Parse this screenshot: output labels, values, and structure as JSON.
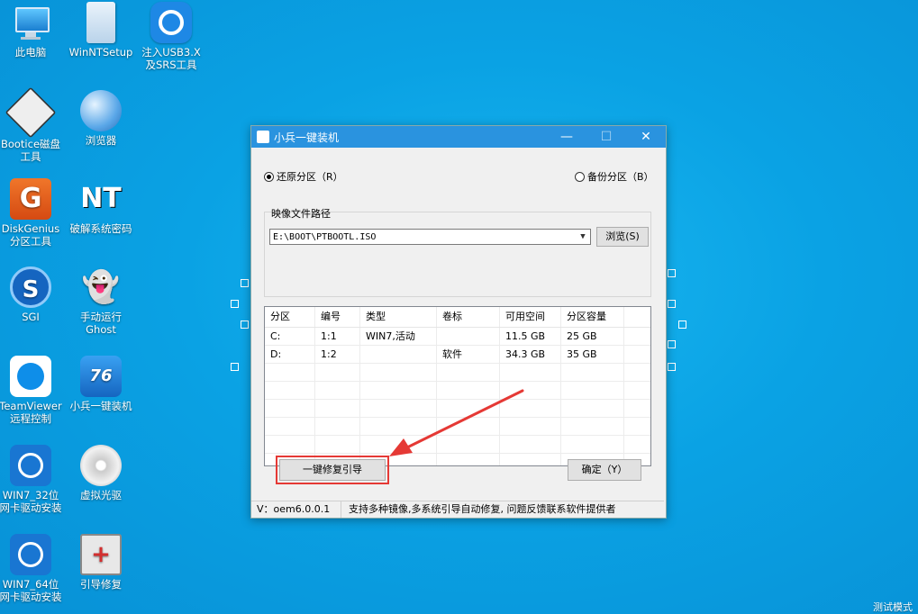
{
  "desktop": {
    "icons": [
      {
        "label": "此电脑",
        "label2": ""
      },
      {
        "label": "WinNTSetup",
        "label2": ""
      },
      {
        "label": "注入USB3.X",
        "label2": "及SRS工具"
      },
      {
        "label": "Bootice磁盘",
        "label2": "工具"
      },
      {
        "label": "浏览器",
        "label2": ""
      },
      {
        "label": "DiskGenius",
        "label2": "分区工具"
      },
      {
        "label": "破解系统密码",
        "label2": ""
      },
      {
        "label": "SGI",
        "label2": ""
      },
      {
        "label": "手动运行",
        "label2": "Ghost"
      },
      {
        "label": "TeamViewer",
        "label2": "远程控制"
      },
      {
        "label": "小兵一键装机",
        "label2": ""
      },
      {
        "label": "WIN7_32位",
        "label2": "网卡驱动安装"
      },
      {
        "label": "虚拟光驱",
        "label2": ""
      },
      {
        "label": "WIN7_64位",
        "label2": "网卡驱动安装"
      },
      {
        "label": "引导修复",
        "label2": ""
      }
    ],
    "corner_text": "测试模式"
  },
  "window": {
    "title": "小兵一键装机",
    "minimize": "—",
    "maximize": "☐",
    "close": "✕",
    "radio_restore": "还原分区（R）",
    "radio_backup": "备份分区（B）",
    "image_path_label": "映像文件路径",
    "image_path_value": "E:\\BOOT\\PTBOOTL.ISO",
    "browse_button": "浏览(S)",
    "table": {
      "headers": [
        "分区",
        "编号",
        "类型",
        "卷标",
        "可用空间",
        "分区容量"
      ],
      "rows": [
        [
          "C:",
          "1:1",
          "WIN7,活动",
          "",
          "11.5 GB",
          "25 GB"
        ],
        [
          "D:",
          "1:2",
          "",
          "软件",
          "34.3 GB",
          "35 GB"
        ]
      ]
    },
    "repair_button": "一键修复引导",
    "ok_button": "确定（Y）",
    "status_version": "V：oem6.0.0.1",
    "status_message": "支持多种镜像,多系统引导自动修复, 问题反馈联系软件提供者"
  },
  "colors": {
    "titlebar": "#2a93df",
    "highlight": "#e53935",
    "desktop": "#0aa2e4"
  }
}
